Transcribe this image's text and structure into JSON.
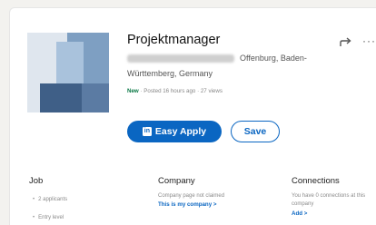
{
  "job": {
    "title": "Projektmanager",
    "location_line1": "Offenburg, Baden-",
    "location_line2": "Württemberg, Germany",
    "new_badge": "New",
    "posted_meta": "· Posted 16 hours ago · 27 views",
    "easy_apply_label": "Easy Apply",
    "linkedin_glyph": "in",
    "save_label": "Save"
  },
  "sections": {
    "job": {
      "heading": "Job",
      "items": [
        "2 applicants",
        "Entry level"
      ]
    },
    "company": {
      "heading": "Company",
      "note": "Company page not claimed",
      "link": "This is my company >"
    },
    "connections": {
      "heading": "Connections",
      "note_line1": "You have 0 connections at this",
      "note_line2": "company",
      "link": "Add >"
    }
  },
  "icons": {
    "share": "share-arrow-icon",
    "more": "more-options-icon",
    "easy_apply": "linkedin-icon"
  },
  "colors": {
    "primary": "#0a66c2",
    "new_badge": "#057642",
    "background": "#f3f2ef"
  }
}
